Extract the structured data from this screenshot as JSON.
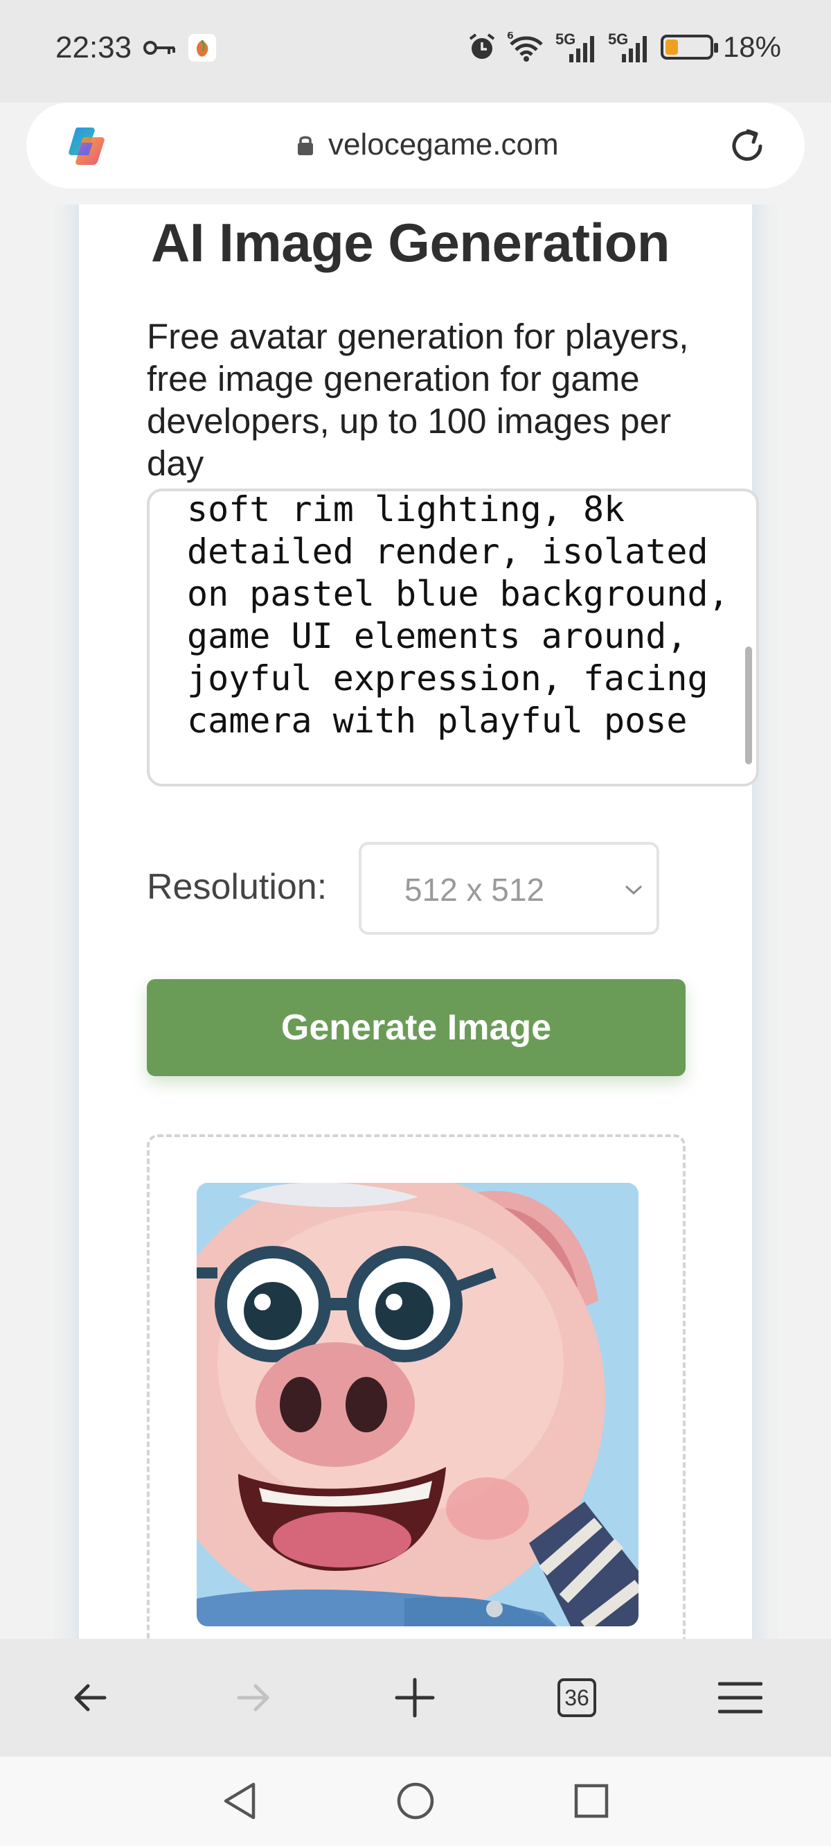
{
  "status_bar": {
    "time": "22:33",
    "battery": "18%",
    "battery_level": 0.18,
    "signal_1": "5G",
    "signal_2": "5G",
    "wifi_tag": "6"
  },
  "browser": {
    "url": "velocegame.com",
    "tabs_count": "36"
  },
  "page": {
    "title": "AI Image Generation",
    "description": "Free avatar generation for players, free image generation for game developers, up to 100 images per day",
    "prompt_text": "soft rim lighting, 8k detailed render, isolated on pastel blue background, game UI elements around, joyful expression, facing camera with playful pose",
    "resolution_label": "Resolution:",
    "resolution_value": "512 x 512",
    "generate_button": "Generate Image"
  },
  "colors": {
    "accent": "#6a9c58",
    "background": "#f2f2f2",
    "card": "#ffffff"
  },
  "icons": {
    "back": "arrow-left-icon",
    "forward": "arrow-right-icon",
    "new_tab": "plus-icon",
    "tabs": "tabs-count-icon",
    "menu": "hamburger-menu-icon",
    "reload": "reload-icon",
    "lock": "lock-icon"
  }
}
